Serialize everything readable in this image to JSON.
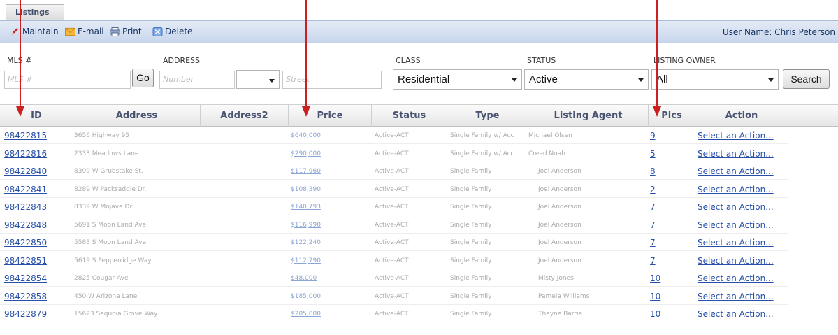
{
  "tabs": {
    "listings": "Listings"
  },
  "toolbar": {
    "maintain": "Maintain",
    "email": "E-mail",
    "print": "Print",
    "delete": "Delete",
    "username": "User Name: Chris Peterson"
  },
  "filters": {
    "mls_label": "MLS #",
    "mls_placeholder": "MLS #",
    "go": "Go",
    "address_label": "ADDRESS",
    "number_placeholder": "Number",
    "street_placeholder": "Street",
    "class_label": "CLASS",
    "class_value": "Residential",
    "status_label": "STATUS",
    "status_value": "Active",
    "owner_label": "LISTING OWNER",
    "owner_value": "All",
    "search": "Search"
  },
  "columns": {
    "id": "ID",
    "address": "Address",
    "address2": "Address2",
    "price": "Price",
    "status": "Status",
    "type": "Type",
    "agent": "Listing Agent",
    "pics": "Pics",
    "action": "Action"
  },
  "rows": [
    {
      "id": "98422815",
      "address": "3656 Highway 95",
      "price": "$640,000",
      "status": "Active-ACT",
      "type": "Single Family w/ Acc",
      "agent": "Michael Olsen",
      "pics": "9",
      "action": "Select an Action..."
    },
    {
      "id": "98422816",
      "address": "2333 Meadows Lane",
      "price": "$290,000",
      "status": "Active-ACT",
      "type": "Single Family w/ Acc",
      "agent": "Creed Noah",
      "pics": "5",
      "action": "Select an Action..."
    },
    {
      "id": "98422840",
      "address": "8399 W Grubstake St.",
      "price": "$117,960",
      "status": "Active-ACT",
      "type": "Single Family",
      "agent": "Joel Anderson",
      "pics": "8",
      "action": "Select an Action..."
    },
    {
      "id": "98422841",
      "address": "8289 W Packsaddle Dr.",
      "price": "$108,390",
      "status": "Active-ACT",
      "type": "Single Family",
      "agent": "Joel Anderson",
      "pics": "2",
      "action": "Select an Action..."
    },
    {
      "id": "98422843",
      "address": "8339 W Mojave Dr.",
      "price": "$140,793",
      "status": "Active-ACT",
      "type": "Single Family",
      "agent": "Joel Anderson",
      "pics": "7",
      "action": "Select an Action..."
    },
    {
      "id": "98422848",
      "address": "5691 S Moon Land Ave.",
      "price": "$116,990",
      "status": "Active-ACT",
      "type": "Single Family",
      "agent": "Joel Anderson",
      "pics": "7",
      "action": "Select an Action..."
    },
    {
      "id": "98422850",
      "address": "5583 S Moon Land Ave.",
      "price": "$122,240",
      "status": "Active-ACT",
      "type": "Single Family",
      "agent": "Joel Anderson",
      "pics": "7",
      "action": "Select an Action..."
    },
    {
      "id": "98422851",
      "address": "5619 S Pepperridge Way",
      "price": "$112,790",
      "status": "Active-ACT",
      "type": "Single Family",
      "agent": "Joel Anderson",
      "pics": "7",
      "action": "Select an Action..."
    },
    {
      "id": "98422854",
      "address": "2825 Cougar Ave",
      "price": "$48,000",
      "status": "Active-ACT",
      "type": "Single Family",
      "agent": "Misty Jones",
      "pics": "10",
      "action": "Select an Action..."
    },
    {
      "id": "98422858",
      "address": "450 W Arizona Lane",
      "price": "$185,000",
      "status": "Active-ACT",
      "type": "Single Family",
      "agent": "Pamela Williams",
      "pics": "10",
      "action": "Select an Action..."
    },
    {
      "id": "98422879",
      "address": "15623 Sequoia Grove Way",
      "price": "$205,000",
      "status": "Active-ACT",
      "type": "Single Family",
      "agent": "Thayne Barrie",
      "pics": "10",
      "action": "Select an Action..."
    }
  ],
  "colors": {
    "accent_arrow": "#cc1f1f",
    "link": "#2850a8",
    "toolbar": "#c7d5ec"
  }
}
